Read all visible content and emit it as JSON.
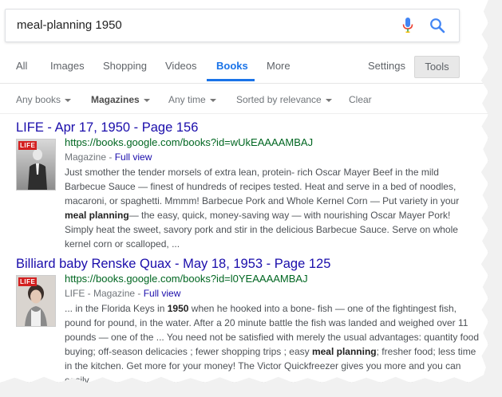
{
  "search": {
    "query": "meal-planning 1950"
  },
  "icons": {
    "mic": "microphone-icon",
    "search": "magnifier-icon"
  },
  "colors": {
    "accent": "#1a73e8",
    "link": "#1a0dab",
    "url": "#006621",
    "text": "#4d5156"
  },
  "tabs": [
    {
      "label": "All"
    },
    {
      "label": "Images"
    },
    {
      "label": "Shopping"
    },
    {
      "label": "Videos"
    },
    {
      "label": "Books",
      "active": true
    },
    {
      "label": "More"
    },
    {
      "label": "Settings"
    }
  ],
  "tools_label": "Tools",
  "filters": [
    {
      "label": "Any books"
    },
    {
      "label": "Magazines"
    },
    {
      "label": "Any time"
    },
    {
      "label": "Sorted by relevance"
    },
    {
      "label": "Clear"
    }
  ],
  "results": [
    {
      "title": "LIFE - Apr 17, 1950 - Page 156",
      "thumb_logo": "LIFE",
      "url": "https://books.google.com/books?id=wUkEAAAAMBAJ",
      "meta_prefix": "Magazine - ",
      "meta_link": "Full view",
      "snippet": [
        {
          "t": "Just smother the tender morsels of extra lean, protein- rich Oscar Mayer Beef in the mild Barbecue Sauce — finest of hundreds of recipes tested. Heat and serve in a bed of noodles, macaroni, or spaghetti. Mmmm! Barbecue Pork and Whole Kernel Corn — Put variety in your "
        },
        {
          "t": "meal planning",
          "b": true
        },
        {
          "t": "— the easy, quick, money-saving way — with nourishing Oscar Mayer Pork! Simply heat the sweet, savory pork and stir in the delicious Barbecue Sauce. Serve on whole kernel corn or scalloped, ..."
        }
      ]
    },
    {
      "title": "Billiard baby Renske Quax - May 18, 1953 - Page 125",
      "thumb_logo": "LIFE",
      "url": "https://books.google.com/books?id=l0YEAAAAMBAJ",
      "meta_prefix": "LIFE - Magazine - ",
      "meta_link": "Full view",
      "snippet": [
        {
          "t": "... in the Florida Keys in "
        },
        {
          "t": "1950",
          "b": true
        },
        {
          "t": " when he hooked into a bone- fish — one of the fightingest fish, pound for pound, in the water. After a 20 minute battle the fish was landed and weighed over 11 pounds — one of the ... You need not be satisfied with merely the usual advantages: quantity food buying; off-season delicacies ; fewer shopping trips ; easy "
        },
        {
          "t": "meal planning",
          "b": true
        },
        {
          "t": "; fresher food; less time in the kitchen. Get more for your money! The Victor Quickfreezer gives you more and you can easily ..."
        }
      ]
    }
  ]
}
